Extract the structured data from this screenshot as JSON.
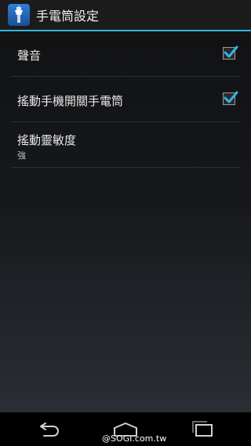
{
  "app": {
    "title": "手電筒設定",
    "icon": "flashlight-icon"
  },
  "preferences": [
    {
      "title": "聲音",
      "checked": true
    },
    {
      "title": "搖動手機開關手電筒",
      "checked": true
    },
    {
      "title": "搖動靈敏度",
      "summary": "強"
    }
  ],
  "nav": {
    "back": "back-icon",
    "home": "home-icon",
    "recents": "recents-icon"
  },
  "watermark": "@SOGI.com.tw",
  "colors": {
    "accent": "#33b5e5",
    "action_bar": "#1b1b1b",
    "text_primary": "#e8e8e8",
    "text_secondary": "#bdbdbd"
  }
}
